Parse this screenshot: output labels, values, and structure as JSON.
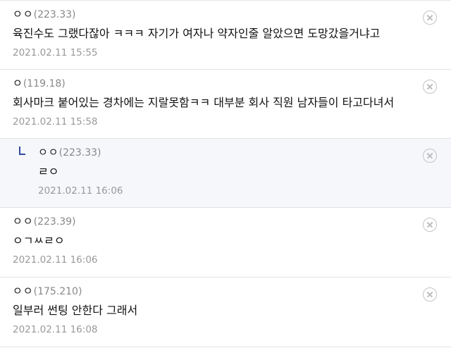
{
  "comments": [
    {
      "author": "ㅇㅇ",
      "ip": "(223.33)",
      "text": "육진수도 그랬다잖아 ㅋㅋㅋ 자기가 여자나 약자인줄 알았으면 도망갔을거냐고",
      "timestamp": "2021.02.11 15:55",
      "is_reply": false
    },
    {
      "author": "ㅇ",
      "ip": "(119.18)",
      "text": "회사마크 붙어있는 경차에는 지랄못함ㅋㅋ 대부분 회사 직원 남자들이 타고다녀서",
      "timestamp": "2021.02.11 15:58",
      "is_reply": false
    },
    {
      "author": "ㅇㅇ",
      "ip": "(223.33)",
      "text": "ㄹㅇ",
      "timestamp": "2021.02.11 16:06",
      "is_reply": true
    },
    {
      "author": "ㅇㅇ",
      "ip": "(223.39)",
      "text": "ㅇㄱㅆㄹㅇ",
      "timestamp": "2021.02.11 16:06",
      "is_reply": false
    },
    {
      "author": "ㅇㅇ",
      "ip": "(175.210)",
      "text": "일부러 썬팅 안한다 그래서",
      "timestamp": "2021.02.11 16:08",
      "is_reply": false
    }
  ],
  "icons": {
    "delete": "close-circle-icon",
    "reply_marker": "reply-arrow-icon"
  },
  "colors": {
    "reply_background": "#f6f7fb",
    "reply_marker": "#2f4a9c",
    "timestamp": "#999999",
    "ip": "#888888",
    "divider": "#e3e3e3"
  }
}
